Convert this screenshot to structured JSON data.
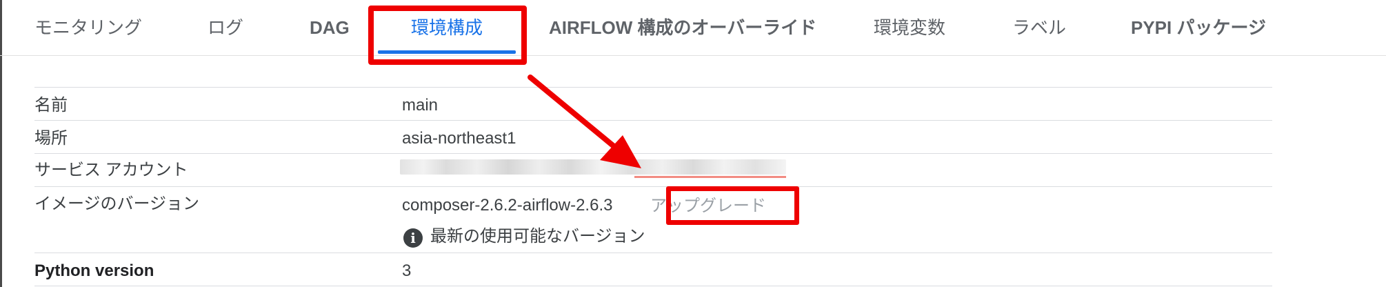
{
  "tabs": [
    {
      "label": "モニタリング"
    },
    {
      "label": "ログ"
    },
    {
      "label": "DAG"
    },
    {
      "label": "環境構成"
    },
    {
      "label": "AIRFLOW 構成のオーバーライド"
    },
    {
      "label": "環境変数"
    },
    {
      "label": "ラベル"
    },
    {
      "label": "PYPI パッケージ"
    }
  ],
  "active_tab": "環境構成",
  "config": {
    "rows": [
      {
        "label": "名前",
        "value": "main"
      },
      {
        "label": "場所",
        "value": "asia-northeast1"
      },
      {
        "label": "サービス アカウント",
        "value": ""
      },
      {
        "label": "イメージのバージョン",
        "value": "composer-2.6.2-airflow-2.6.3"
      },
      {
        "label": "Python version",
        "value": "3"
      }
    ],
    "upgrade_label": "アップグレード",
    "info_message": "最新の使用可能なバージョン"
  },
  "colors": {
    "accent": "#1a73e8",
    "annotation": "#ee0000"
  },
  "icons": {
    "info": "info-icon"
  }
}
